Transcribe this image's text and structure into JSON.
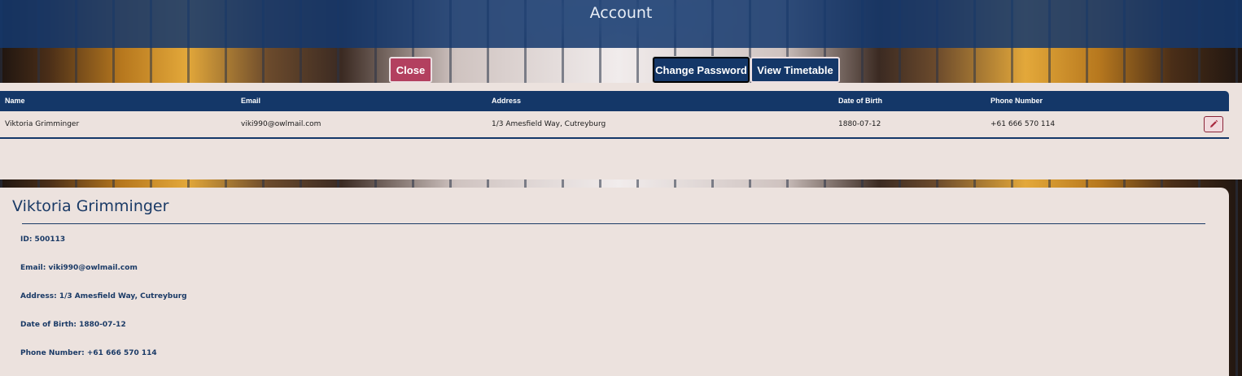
{
  "header": {
    "title": "Account"
  },
  "actions": {
    "close_label": "Close",
    "change_password_label": "Change Password",
    "view_timetable_label": "View Timetable"
  },
  "table": {
    "columns": [
      "Name",
      "Email",
      "Address",
      "Date of Birth",
      "Phone Number"
    ],
    "rows": [
      [
        "Viktoria Grimminger",
        "viki990@owlmail.com",
        "1/3 Amesfield Way, Cutreyburg",
        "1880-07-12",
        "+61 666 570 114"
      ]
    ],
    "edit_icon": "pencil-icon"
  },
  "profile": {
    "name": "Viktoria Grimminger",
    "details": [
      "ID: 500113",
      "Email: viki990@owlmail.com",
      "Address: 1/3 Amesfield Way, Cutreyburg",
      "Date of Birth: 1880-07-12",
      "Phone Number: +61 666 570 114"
    ]
  },
  "colors": {
    "primary": "#143768",
    "danger": "#b3405f",
    "panel": "#ece2de"
  }
}
